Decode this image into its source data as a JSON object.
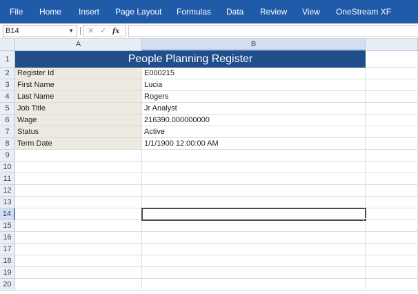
{
  "ribbon": {
    "items": [
      "File",
      "Home",
      "Insert",
      "Page Layout",
      "Formulas",
      "Data",
      "Review",
      "View",
      "OneStream XF"
    ]
  },
  "formula_bar": {
    "name_box": "B14",
    "cancel_glyph": "✕",
    "enter_glyph": "✓",
    "function_glyph": "fx",
    "formula_value": ""
  },
  "grid": {
    "columns": [
      "A",
      "B"
    ],
    "rows": [
      "1",
      "2",
      "3",
      "4",
      "5",
      "6",
      "7",
      "8",
      "9",
      "10",
      "11",
      "12",
      "13",
      "14",
      "15",
      "16",
      "17",
      "18",
      "19",
      "20"
    ],
    "title": "People Planning Register",
    "records": [
      {
        "label": "Register Id",
        "value": "E000215"
      },
      {
        "label": "First Name",
        "value": "Lucia"
      },
      {
        "label": "Last Name",
        "value": "Rogers"
      },
      {
        "label": "Job Title",
        "value": "Jr Analyst"
      },
      {
        "label": "Wage",
        "value": "216390.000000000"
      },
      {
        "label": "Status",
        "value": "Active"
      },
      {
        "label": "Term Date",
        "value": "1/1/1900 12:00:00 AM"
      }
    ],
    "active_cell": "B14",
    "colors": {
      "ribbon": "#1f5ba8",
      "title_band": "#1f4e8a",
      "label_fill": "#edeae0"
    }
  }
}
